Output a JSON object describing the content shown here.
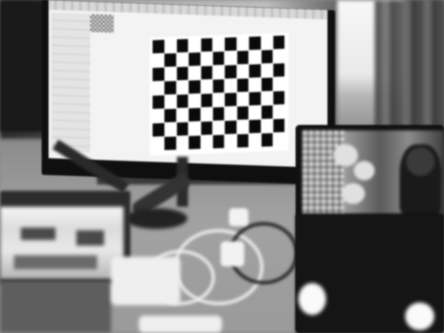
{
  "scene": {
    "checkerboard": {
      "rows": 8,
      "cols": 11
    }
  },
  "colors": {
    "monitor_bezel": "#0f0f0f",
    "screen": "#f3f3f3",
    "checker_dark": "#0a0a0a",
    "desk": "#9a9a9a",
    "tablet": "#151515"
  }
}
